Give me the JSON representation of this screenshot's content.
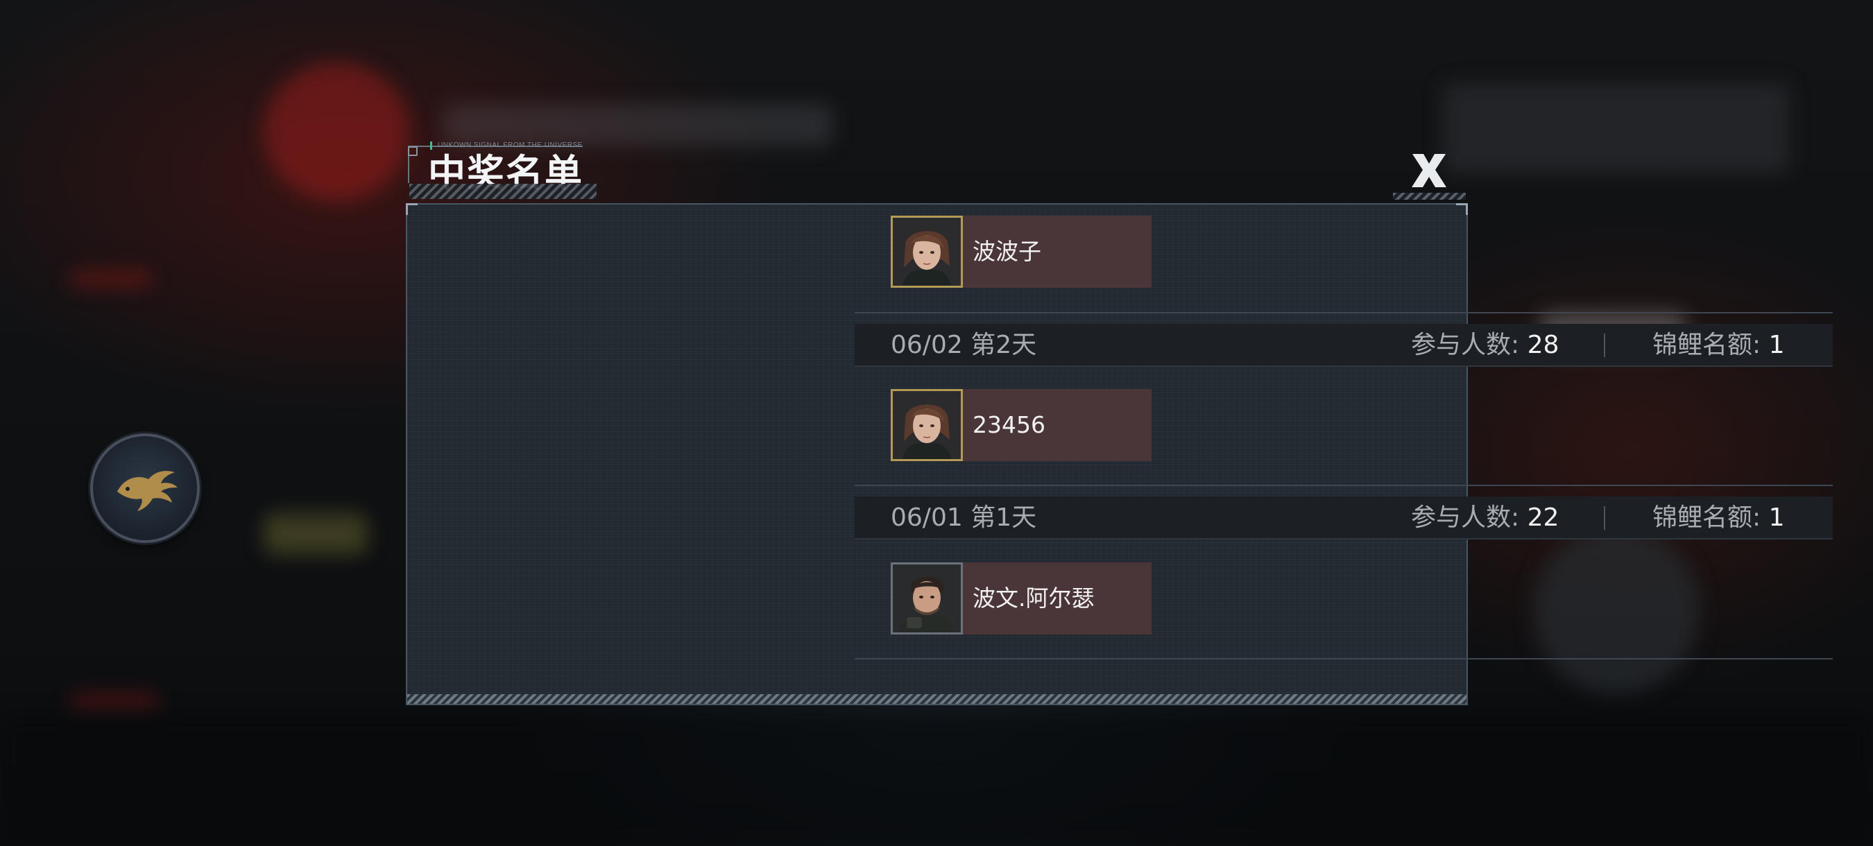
{
  "dialog": {
    "title": "中奖名单",
    "subtitle": "UNKOWN SIGNAL FROM THE UNIVERSE",
    "close_icon": "close-x-icon"
  },
  "side_emblem": {
    "icon": "phoenix-emblem-icon"
  },
  "entries": [
    {
      "winner": {
        "name": "波波子",
        "avatar": "female-portrait",
        "frame": "gold"
      }
    },
    {
      "day": {
        "date": "06/02",
        "label": "第2天"
      },
      "participants_label": "参与人数:",
      "participants": "28",
      "quota_label": "锦鲤名额:",
      "quota": "1",
      "winner": {
        "name": "23456",
        "avatar": "female-portrait",
        "frame": "gold"
      }
    },
    {
      "day": {
        "date": "06/01",
        "label": "第1天"
      },
      "participants_label": "参与人数:",
      "participants": "22",
      "quota_label": "锦鲤名额:",
      "quota": "1",
      "winner": {
        "name": "波文.阿尔瑟",
        "avatar": "male-portrait",
        "frame": "silver"
      }
    }
  ]
}
